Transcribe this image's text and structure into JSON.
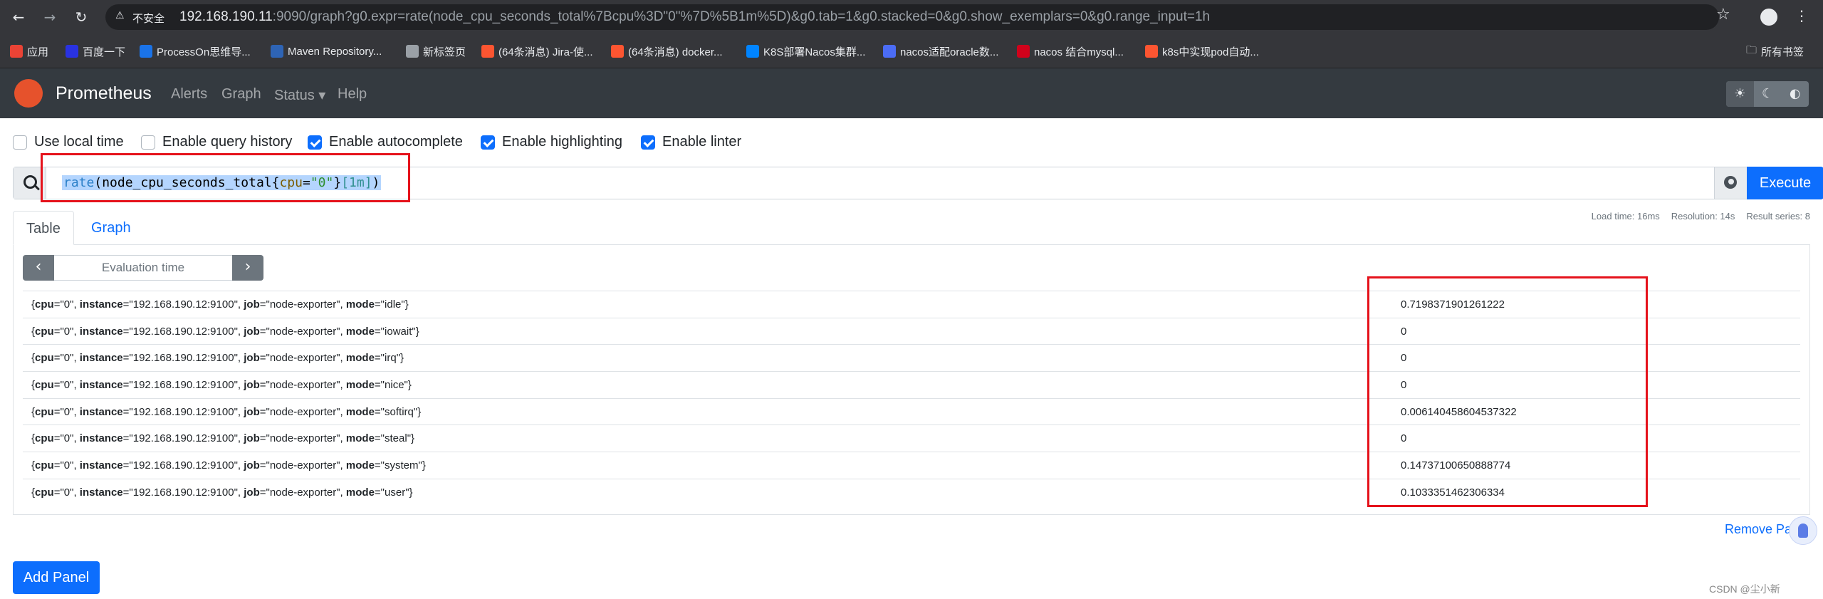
{
  "browser": {
    "security_label": "不安全",
    "url_host": "192.168.190.11",
    "url_rest": ":9090/graph?g0.expr=rate(node_cpu_seconds_total%7Bcpu%3D\"0\"%7D%5B1m%5D)&g0.tab=1&g0.stacked=0&g0.show_exemplars=0&g0.range_input=1h",
    "bookmarks": [
      {
        "label": "应用",
        "color": "#ea4335"
      },
      {
        "label": "百度一下",
        "color": "#2932e1"
      },
      {
        "label": "ProcessOn思维导...",
        "color": "#1a73e8"
      },
      {
        "label": "Maven Repository...",
        "color": "#2e64b5"
      },
      {
        "label": "新标签页",
        "color": "#9aa0a6"
      },
      {
        "label": "(64条消息) Jira-使...",
        "color": "#fc5531"
      },
      {
        "label": "(64条消息) docker...",
        "color": "#fc5531"
      },
      {
        "label": "K8S部署Nacos集群...",
        "color": "#0084ff"
      },
      {
        "label": "nacos适配oracle数...",
        "color": "#4b6cf5"
      },
      {
        "label": "nacos 结合mysql...",
        "color": "#d0021b"
      },
      {
        "label": "k8s中实现pod自动...",
        "color": "#fc5531"
      }
    ],
    "all_bookmarks": "所有书签"
  },
  "navbar": {
    "brand": "Prometheus",
    "links": [
      "Alerts",
      "Graph",
      "Status ▾",
      "Help"
    ]
  },
  "options": [
    {
      "label": "Use local time",
      "checked": false
    },
    {
      "label": "Enable query history",
      "checked": false
    },
    {
      "label": "Enable autocomplete",
      "checked": true
    },
    {
      "label": "Enable highlighting",
      "checked": true
    },
    {
      "label": "Enable linter",
      "checked": true
    }
  ],
  "expression": {
    "fn": "rate",
    "open": "(",
    "metric": "node_cpu_seconds_total",
    "brace_open": "{",
    "label": "cpu",
    "eq": "=",
    "label_value": "\"0\"",
    "brace_close": "}",
    "range": "[1m]",
    "close": ")"
  },
  "execute_label": "Execute",
  "tabs": {
    "table": "Table",
    "graph": "Graph"
  },
  "stats": {
    "load_time": "Load time: 16ms",
    "resolution": "Resolution: 14s",
    "result_series": "Result series: 8"
  },
  "eval": {
    "prev": "‹",
    "next": "›",
    "placeholder": "Evaluation time"
  },
  "results": [
    {
      "cpu": "0",
      "instance": "192.168.190.12:9100",
      "job": "node-exporter",
      "mode": "idle",
      "value": "0.7198371901261222"
    },
    {
      "cpu": "0",
      "instance": "192.168.190.12:9100",
      "job": "node-exporter",
      "mode": "iowait",
      "value": "0"
    },
    {
      "cpu": "0",
      "instance": "192.168.190.12:9100",
      "job": "node-exporter",
      "mode": "irq",
      "value": "0"
    },
    {
      "cpu": "0",
      "instance": "192.168.190.12:9100",
      "job": "node-exporter",
      "mode": "nice",
      "value": "0"
    },
    {
      "cpu": "0",
      "instance": "192.168.190.12:9100",
      "job": "node-exporter",
      "mode": "softirq",
      "value": "0.006140458604537322"
    },
    {
      "cpu": "0",
      "instance": "192.168.190.12:9100",
      "job": "node-exporter",
      "mode": "steal",
      "value": "0"
    },
    {
      "cpu": "0",
      "instance": "192.168.190.12:9100",
      "job": "node-exporter",
      "mode": "system",
      "value": "0.14737100650888774"
    },
    {
      "cpu": "0",
      "instance": "192.168.190.12:9100",
      "job": "node-exporter",
      "mode": "user",
      "value": "0.1033351462306334"
    }
  ],
  "remove_panel": "Remove Pa",
  "add_panel": "Add Panel",
  "watermark": "CSDN @尘小新"
}
